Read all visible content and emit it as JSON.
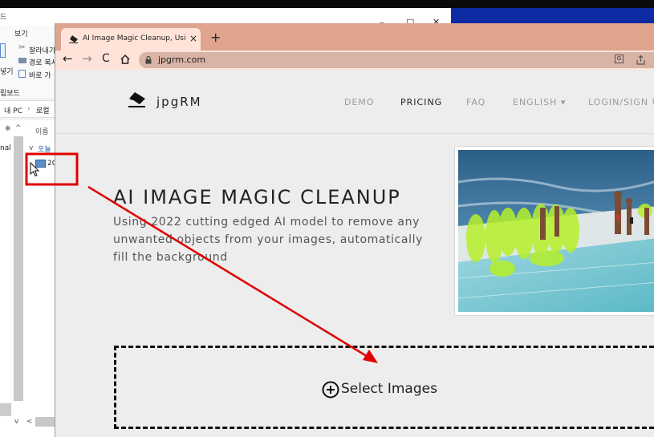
{
  "explorer": {
    "title_fragment": "드",
    "window_controls": {
      "minimize": "–",
      "maximize": "□",
      "close": "✕"
    },
    "view_tab": "보기",
    "ribbon": {
      "open_fragment": "넣기",
      "cut": "잘라내기",
      "copy_path": "경로 복사",
      "paste_shortcut": "바로 가"
    },
    "clipboard_group": "립보드",
    "breadcrumb": [
      "내 PC",
      "로컬"
    ],
    "column_header": "이름",
    "group_today": "오늘",
    "file_item": "20",
    "left_item": "nal"
  },
  "browser": {
    "tab_title": "AI Image Magic Cleanup, Using",
    "tab_close": "×",
    "new_tab": "+",
    "url": "jpgrm.com"
  },
  "site": {
    "logo": "jpgRM",
    "nav": {
      "demo": "DEMO",
      "pricing": "PRICING",
      "faq": "FAQ",
      "language": "ENGLISH ▾",
      "login": "LOGIN/SIGN UP"
    },
    "hero_title": "AI IMAGE MAGIC CLEANUP",
    "hero_subtitle": "Using 2022 cutting edged AI model to remove any unwanted objects from your images, automatically fill the background",
    "select_images": "Select Images"
  },
  "colors": {
    "tab_strip": "#dea48e",
    "toolbar": "#ffe3d8",
    "annotation": "#e00000",
    "mask": "#b6f02a"
  }
}
